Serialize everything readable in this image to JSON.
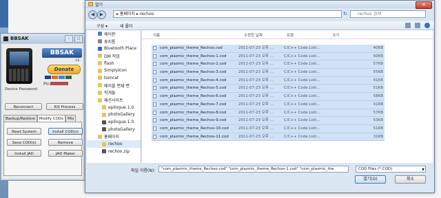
{
  "bbsak": {
    "title": "BBSAK",
    "logo": "BBSAK",
    "version": "v1.",
    "donate_label": "Donate",
    "pin_label": "Pin:",
    "device_password_label": "Device Password:",
    "buttons": {
      "reconnect": "Reconnect",
      "kill_process": "Kill Process",
      "read_system": "Read System",
      "install_cods": "Install COD(s)",
      "save_cods": "Save COD(s)",
      "remove": "Remove",
      "install_jad": "Install JAD",
      "jad_maker": "JAD Maker"
    },
    "tabs": [
      "Backup/Restore",
      "Modify CODs",
      "Mis"
    ]
  },
  "dialog": {
    "title": "열기",
    "address": "▸ 홈페이지 ▸ rechoo",
    "search_placeholder": "rechoo 검색",
    "toolbar": {
      "organize": "구성 ▾",
      "new_folder": "새 폴더"
    },
    "nav_items": [
      {
        "label": "제어판",
        "color": "#4d82c4",
        "indent": false
      },
      {
        "label": "휴지통",
        "color": "#7a8aa0",
        "indent": false
      },
      {
        "label": "Bluetooth Place",
        "color": "#2f6ccf",
        "indent": false
      },
      {
        "label": "DM 작업",
        "color": "#e4c25e",
        "indent": false
      },
      {
        "label": "flash",
        "color": "#e4c25e",
        "indent": false
      },
      {
        "label": "SimplyIcon",
        "color": "#e4c25e",
        "indent": false
      },
      {
        "label": "tomcat",
        "color": "#e4c25e",
        "indent": false
      },
      {
        "label": "베리블 편재 변",
        "color": "#e4c25e",
        "indent": false
      },
      {
        "label": "작개들",
        "color": "#e4c25e",
        "indent": false
      },
      {
        "label": "패션사이트",
        "color": "#e4c25e",
        "indent": false
      },
      {
        "label": "epilogue.1.0.",
        "color": "#e4c25e",
        "indent": true
      },
      {
        "label": "photoGallery",
        "color": "#e4c25e",
        "indent": true
      },
      {
        "label": "epilogue.1.0.",
        "color": "#555555",
        "indent": true
      },
      {
        "label": "photoGallery",
        "color": "#555555",
        "indent": true
      },
      {
        "label": "홈페이지",
        "color": "#e4c25e",
        "indent": false
      },
      {
        "label": "rechoo",
        "color": "#e4c25e",
        "indent": true,
        "selected": true
      },
      {
        "label": "rechoo.zip",
        "color": "#555555",
        "indent": true
      }
    ],
    "columns": {
      "name": "이름",
      "date": "수정한 날짜",
      "type": "유형",
      "size": "크기"
    },
    "files": [
      {
        "name": "com_plazmic_theme_Rechoo.cod",
        "date": "2011-07-23 오후 ...",
        "type": "C/C++ Code Listi...",
        "size": "40KB"
      },
      {
        "name": "com_plazmic_theme_Rechoo-1.cod",
        "date": "2011-07-23 오후 ...",
        "type": "C/C++ Code Listi...",
        "size": "60KB"
      },
      {
        "name": "com_plazmic_theme_Rechoo-2.cod",
        "date": "2011-07-23 오후 ...",
        "type": "C/C++ Code Listi...",
        "size": "57KB"
      },
      {
        "name": "com_plazmic_theme_Rechoo-3.cod",
        "date": "2011-07-23 오후 ...",
        "type": "C/C++ Code Listi...",
        "size": "55KB"
      },
      {
        "name": "com_plazmic_theme_Rechoo-4.cod",
        "date": "2011-07-23 오후 ...",
        "type": "C/C++ Code Listi...",
        "size": "41KB"
      },
      {
        "name": "com_plazmic_theme_Rechoo-5.cod",
        "date": "2011-07-23 오후 ...",
        "type": "C/C++ Code Listi...",
        "size": "51KB"
      },
      {
        "name": "com_plazmic_theme_Rechoo-6.cod",
        "date": "2011-07-23 오후 ...",
        "type": "C/C++ Code Listi...",
        "size": "58KB"
      },
      {
        "name": "com_plazmic_theme_Rechoo-7.cod",
        "date": "2011-07-23 오후 ...",
        "type": "C/C++ Code Listi...",
        "size": "41KB"
      },
      {
        "name": "com_plazmic_theme_Rechoo-8.cod",
        "date": "2011-07-23 오후 ...",
        "type": "C/C++ Code Listi...",
        "size": "57KB"
      },
      {
        "name": "com_plazmic_theme_Rechoo-9.cod",
        "date": "2011-07-23 오후 ...",
        "type": "C/C++ Code Listi...",
        "size": "53KB"
      },
      {
        "name": "com_plazmic_theme_Rechoo-10.cod",
        "date": "2011-07-23 오후 ...",
        "type": "C/C++ Code Listi...",
        "size": "51KB"
      },
      {
        "name": "com_plazmic_theme_Rechoo-11.cod",
        "date": "2011-07-23 오후 ...",
        "type": "C/C++ Code Listi...",
        "size": "31KB"
      }
    ],
    "filename_label": "파일 이름(N):",
    "filename_value": "\"com_plazmic_theme_Rechoo.cod\" \"com_plazmic_theme_Rechoo-1.cod\" \"com_plazmic_the",
    "filetype_value": "COD Files (*.COD)",
    "open_label": "열기(O)",
    "cancel_label": "취소"
  }
}
